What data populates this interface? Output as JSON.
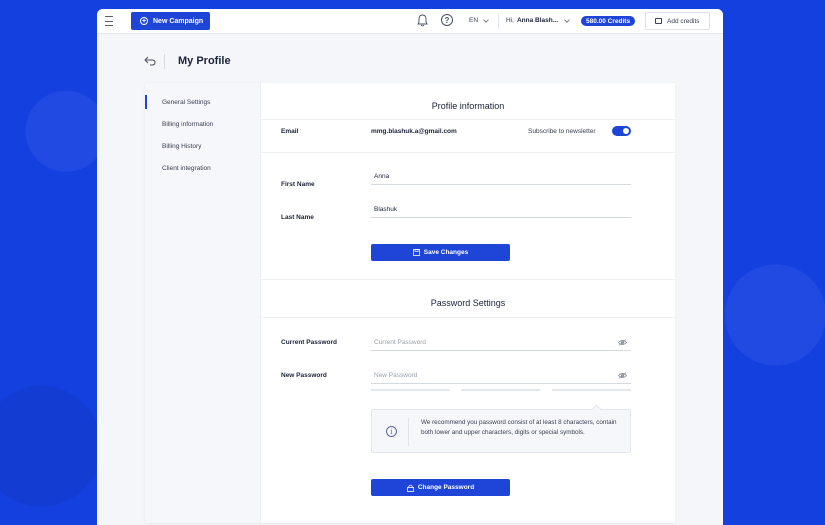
{
  "topbar": {
    "new_campaign_label": "New Campaign",
    "language": "EN",
    "greeting": "Hi,",
    "user_name": "Anna Blash...",
    "credits": "580.00 Credits",
    "add_credits_label": "Add credits"
  },
  "page": {
    "title": "My Profile"
  },
  "sidebar": {
    "items": [
      {
        "label": "General Settings"
      },
      {
        "label": "Billing information"
      },
      {
        "label": "Billing History"
      },
      {
        "label": "Client integration"
      }
    ]
  },
  "profile": {
    "section_title": "Profile information",
    "email_label": "Email",
    "email_value": "mmg.blashuk.a@gmail.com",
    "newsletter_label": "Subscribe to newsletter",
    "newsletter_enabled": true,
    "first_name_label": "First Name",
    "first_name_value": "Anna",
    "last_name_label": "Last Name",
    "last_name_value": "Blashuk",
    "save_label": "Save Changes"
  },
  "password": {
    "section_title": "Password Settings",
    "current_label": "Current Password",
    "current_placeholder": "Current Password",
    "new_label": "New Password",
    "new_placeholder": "New Password",
    "hint": "We recommend you password consist of at least 8 characters, contain both lower and upper characters, digits or special symbols.",
    "change_label": "Change Password"
  },
  "colors": {
    "accent": "#1e44d8",
    "background": "#1440e0"
  }
}
